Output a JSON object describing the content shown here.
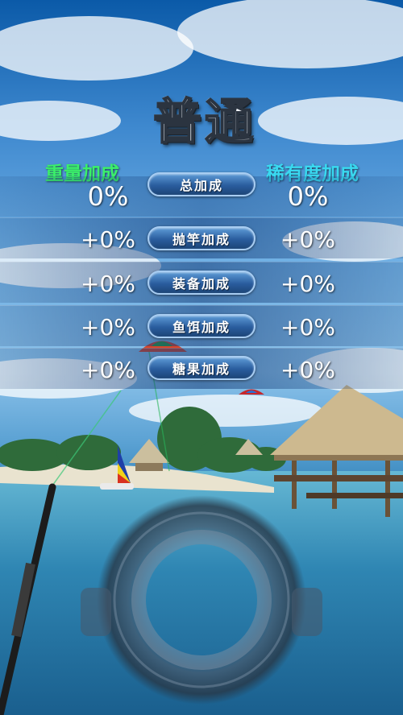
{
  "title": "普通",
  "columns": {
    "left": "重量加成",
    "right": "稀有度加成"
  },
  "rows": [
    {
      "label": "总加成",
      "left": "0%",
      "right": "0%"
    },
    {
      "label": "抛竿加成",
      "left": "+0%",
      "right": "+0%"
    },
    {
      "label": "装备加成",
      "left": "+0%",
      "right": "+0%"
    },
    {
      "label": "鱼饵加成",
      "left": "+0%",
      "right": "+0%"
    },
    {
      "label": "糖果加成",
      "left": "+0%",
      "right": "+0%"
    }
  ]
}
